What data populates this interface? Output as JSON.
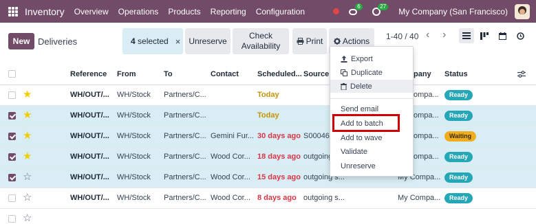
{
  "navbar": {
    "app_name": "Inventory",
    "menu": [
      "Overview",
      "Operations",
      "Products",
      "Reporting",
      "Configuration"
    ],
    "chat_count": "6",
    "activity_count": "27",
    "company": "My Company (San Francisco)",
    "icons": [
      "apps-grid-icon",
      "red-dot-icon",
      "chat-icon",
      "clock-icon",
      "avatar"
    ]
  },
  "control": {
    "new_label": "New",
    "breadcrumb": "Deliveries",
    "selected_count": "4",
    "selected_text": " selected",
    "clear_icon": "×",
    "unreserve_label": "Unreserve",
    "check_label_1": "Check",
    "check_label_2": "Availability",
    "print_label": "Print",
    "actions_label": "Actions",
    "pager": "1-40 / 40",
    "prev_icon": "‹",
    "next_icon": "›"
  },
  "table": {
    "headers": {
      "reference": "Reference",
      "from": "From",
      "to": "To",
      "contact": "Contact",
      "scheduled": "Scheduled...",
      "source": "Source",
      "company": "pany",
      "status": "Status"
    },
    "rows": [
      {
        "ref": "WH/OUT/...",
        "from": "WH/Stock",
        "to": "Partners/C...",
        "contact": "",
        "date": "Today",
        "source": "",
        "company": "ompa...",
        "status": "Ready"
      },
      {
        "ref": "WH/OUT/...",
        "from": "WH/Stock",
        "to": "Partners/C...",
        "contact": "",
        "date": "Today",
        "source": "",
        "company": "ompa...",
        "status": "Ready"
      },
      {
        "ref": "WH/OUT/...",
        "from": "WH/Stock",
        "to": "Partners/C...",
        "contact": "Gemini Fur...",
        "date": "30 days ago",
        "source": "S00046",
        "company": "ompa...",
        "status": "Waiting"
      },
      {
        "ref": "WH/OUT/...",
        "from": "WH/Stock",
        "to": "Partners/C...",
        "contact": "Wood Cor...",
        "date": "18 days ago",
        "source": "outgoing",
        "company": "ompa...",
        "status": "Ready"
      },
      {
        "ref": "WH/OUT/...",
        "from": "WH/Stock",
        "to": "Partners/C...",
        "contact": "Wood Cor...",
        "date": "15 days ago",
        "source": "outgoing s...",
        "company": "My Compa...",
        "status": "Ready"
      },
      {
        "ref": "WH/OUT/...",
        "from": "WH/Stock",
        "to": "Partners/C...",
        "contact": "Wood Cor...",
        "date": "8 days ago",
        "source": "outgoing s...",
        "company": "My Compa...",
        "status": "Ready"
      }
    ]
  },
  "dropdown": {
    "export": "Export",
    "duplicate": "Duplicate",
    "delete": "Delete",
    "send_email": "Send email",
    "add_to_batch": "Add to batch",
    "add_to_wave": "Add to wave",
    "validate": "Validate",
    "unreserve": "Unreserve"
  },
  "colors": {
    "brand": "#714b67",
    "selected_row": "#d8eef4",
    "ready": "#26a7b8",
    "waiting": "#f0ad1e",
    "date_today": "#c59208",
    "date_overdue": "#dc3545",
    "highlight": "#d10000"
  }
}
